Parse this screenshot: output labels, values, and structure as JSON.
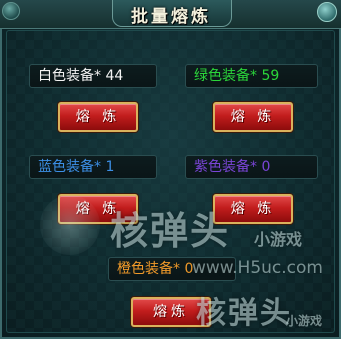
{
  "dialog": {
    "title": "批量熔炼"
  },
  "equipment": [
    {
      "label": "白色装备",
      "count": "* 44",
      "color": "#f4f4f4",
      "button": "熔 炼"
    },
    {
      "label": "绿色装备",
      "count": "* 59",
      "color": "#2bd53a",
      "button": "熔 炼"
    },
    {
      "label": "蓝色装备",
      "count": "* 1",
      "color": "#3c8fe6",
      "button": "熔 炼"
    },
    {
      "label": "紫色装备",
      "count": "* 0",
      "color": "#7a45d6",
      "button": "熔 炼"
    },
    {
      "label": "橙色装备",
      "count": "* 0",
      "color": "#f09a2a",
      "button": "熔炼"
    }
  ],
  "watermark": {
    "brand_1": "核弹头",
    "sub_1": "小游戏",
    "url": "www.H5uc.com",
    "brand_2": "核弹头",
    "sub_2": "小游戏"
  },
  "colors": {
    "button_red": "#c21d1d",
    "button_border_gold": "#d9b25c",
    "panel_teal": "#17393e"
  },
  "icons": {
    "close": "close-icon"
  }
}
